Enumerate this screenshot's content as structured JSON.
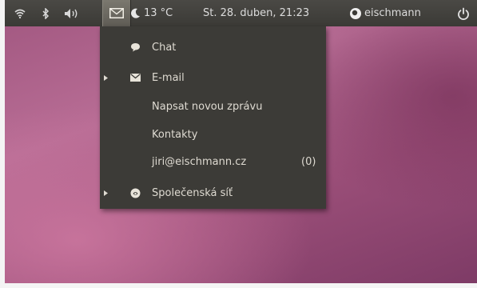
{
  "panel": {
    "temperature": "13 °C",
    "datetime": "St. 28. duben, 21:23",
    "username": "eischmann"
  },
  "messaging_menu": {
    "items": [
      {
        "label": "Chat",
        "icon": "chat-bubble-icon"
      },
      {
        "label": "E-mail",
        "icon": "envelope-icon"
      },
      {
        "label": "Napsat novou zprávu"
      },
      {
        "label": "Kontakty"
      },
      {
        "label": "jiri@eischmann.cz",
        "count": "(0)"
      },
      {
        "label": "Společenská síť",
        "icon": "social-network-icon"
      }
    ]
  }
}
